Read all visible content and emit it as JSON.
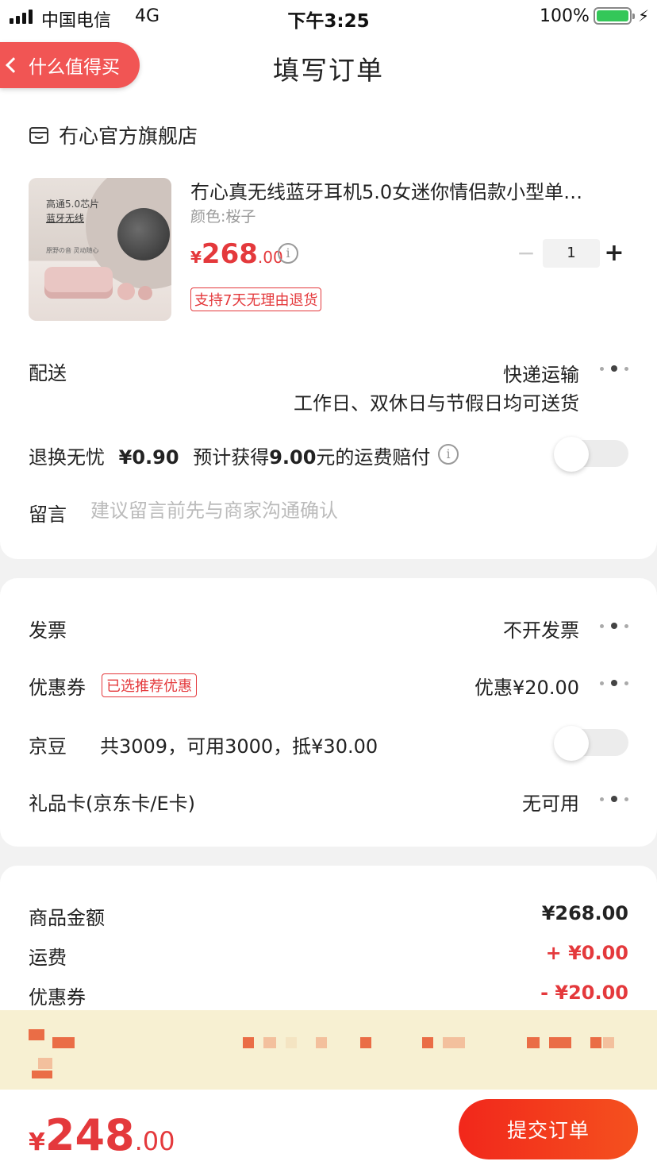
{
  "status_bar": {
    "carrier": "中国电信",
    "network": "4G",
    "time": "下午3:25",
    "battery": "100%"
  },
  "header": {
    "back_label": "什么值得买",
    "title": "填写订单"
  },
  "store": {
    "name": "冇心官方旗舰店",
    "icon": "store-icon"
  },
  "product": {
    "title": "冇心真无线蓝牙耳机5.0女迷你情侣款小型单…",
    "variant": "颜色:桜子",
    "price_currency": "¥",
    "price_int": "268",
    "price_dec": ".00",
    "quantity": "1",
    "minus": "−",
    "plus": "+",
    "return_tag": "支持7天无理由退货",
    "image_text_1": "高通5.0芯片",
    "image_text_2": "蓝牙无线",
    "image_text_3": "原野の音 灵动随心"
  },
  "delivery": {
    "label": "配送",
    "method": "快递运输",
    "note": "工作日、双休日与节假日均可送货"
  },
  "insurance": {
    "label": "退换无忧",
    "price": "¥0.90",
    "text_a": "预计获得",
    "amount": "9.00",
    "text_b": "元的运费赔付",
    "enabled": false
  },
  "message": {
    "label": "留言",
    "placeholder": "建议留言前先与商家沟通确认",
    "value": ""
  },
  "invoice": {
    "label": "发票",
    "value": "不开发票"
  },
  "coupon": {
    "label": "优惠券",
    "tag": "已选推荐优惠",
    "value": "优惠¥20.00"
  },
  "jingdou": {
    "label": "京豆",
    "text": "共3009，可用3000，抵¥30.00",
    "enabled": false
  },
  "giftcard": {
    "label": "礼品卡(京东卡/E卡)",
    "value": "无可用"
  },
  "summary": {
    "goods_label": "商品金额",
    "goods_value": "¥268.00",
    "shipping_label": "运费",
    "shipping_value": "+ ¥0.00",
    "coupon_label": "优惠券",
    "coupon_value": "- ¥20.00"
  },
  "bottom": {
    "total_currency": "¥",
    "total_int": "248",
    "total_dec": ".00",
    "submit_label": "提交订单"
  },
  "colors": {
    "accent": "#e4393c",
    "back_pill": "#f15554",
    "banner": "#f7f0d2",
    "battery": "#34c759"
  }
}
